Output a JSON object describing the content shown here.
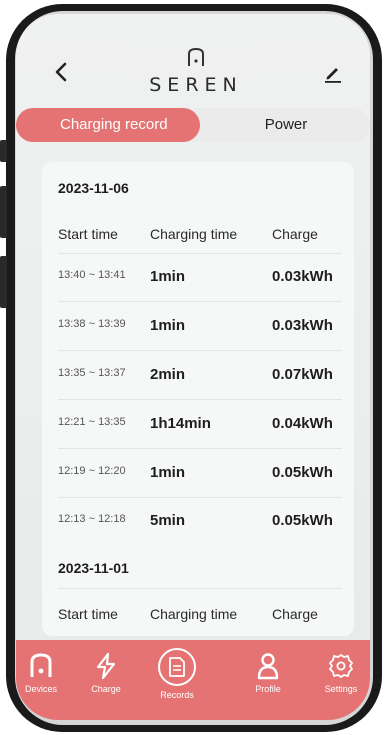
{
  "header": {
    "logo_text": "SEREN"
  },
  "tabs": [
    {
      "label": "Charging record",
      "active": true
    },
    {
      "label": "Power",
      "active": false
    }
  ],
  "records": {
    "columns": [
      "Start time",
      "Charging time",
      "Charge"
    ],
    "groups": [
      {
        "date": "2023-11-06",
        "rows": [
          {
            "time": "13:40 ~ 13:41",
            "duration": "1min",
            "charge": "0.03kWh"
          },
          {
            "time": "13:38 ~ 13:39",
            "duration": "1min",
            "charge": "0.03kWh"
          },
          {
            "time": "13:35 ~ 13:37",
            "duration": "2min",
            "charge": "0.07kWh"
          },
          {
            "time": "12:21 ~ 13:35",
            "duration": "1h14min",
            "charge": "0.04kWh"
          },
          {
            "time": "12:19 ~ 12:20",
            "duration": "1min",
            "charge": "0.05kWh"
          },
          {
            "time": "12:13 ~ 12:18",
            "duration": "5min",
            "charge": "0.05kWh"
          }
        ]
      },
      {
        "date": "2023-11-01",
        "rows": []
      }
    ]
  },
  "nav": [
    {
      "label": "Devices",
      "icon": "devices-icon"
    },
    {
      "label": "Charge",
      "icon": "charge-icon"
    },
    {
      "label": "Records",
      "icon": "records-icon",
      "active": true
    },
    {
      "label": "Profile",
      "icon": "profile-icon"
    },
    {
      "label": "Settings",
      "icon": "settings-icon"
    }
  ],
  "colors": {
    "accent": "#e57373",
    "background": "#eceeee",
    "card": "#f6f7f7",
    "text": "#1e1e1e"
  }
}
